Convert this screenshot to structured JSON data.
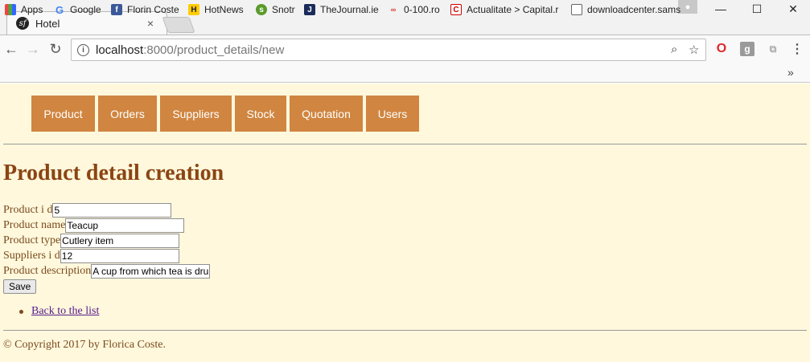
{
  "browser": {
    "tab_title": "Hotel",
    "tab_close": "×",
    "url_host": "localhost",
    "url_rest": ":8000/product_details/new",
    "window_controls": {
      "minimize": "—",
      "maximize": "☐",
      "close": "✕"
    },
    "bookmarks": [
      {
        "label": "Apps",
        "icon": "apps-grid-icon"
      },
      {
        "label": "Google",
        "icon": "google-icon"
      },
      {
        "label": "Florin Coste",
        "icon": "facebook-icon"
      },
      {
        "label": "HotNews",
        "icon": "hotnews-icon"
      },
      {
        "label": "Snotr",
        "icon": "snotr-icon"
      },
      {
        "label": "TheJournal.ie",
        "icon": "thejournal-icon"
      },
      {
        "label": "0-100.ro",
        "icon": "0-100-icon"
      },
      {
        "label": "Actualitate > Capital.r",
        "icon": "capital-icon"
      },
      {
        "label": "downloadcenter.sams",
        "icon": "document-icon"
      }
    ],
    "bookmarks_more": "»"
  },
  "nav": {
    "items": [
      {
        "label": "Product"
      },
      {
        "label": "Orders"
      },
      {
        "label": "Suppliers"
      },
      {
        "label": "Stock"
      },
      {
        "label": "Quotation"
      },
      {
        "label": "Users"
      }
    ]
  },
  "page": {
    "title": "Product detail creation",
    "form": {
      "fields": [
        {
          "label": "Product i d",
          "value": "5"
        },
        {
          "label": "Product name",
          "value": "Teacup"
        },
        {
          "label": "Product type",
          "value": "Cutlery item"
        },
        {
          "label": "Suppliers i d",
          "value": "12"
        },
        {
          "label": "Product description",
          "value": "A cup from which tea is dru"
        }
      ],
      "save_label": "Save"
    },
    "back_link": "Back to the list",
    "copyright": "© Copyright 2017 by Florica Coste."
  },
  "colors": {
    "page_background": "#fff8dc",
    "menu_background": "#d08540",
    "title_color": "#8b4513"
  }
}
